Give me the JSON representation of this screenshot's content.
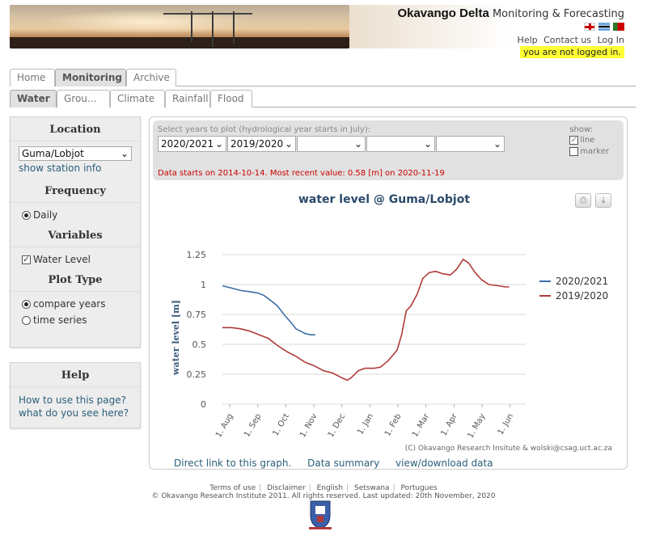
{
  "header": {
    "site_title_bold": "Okavango Delta",
    "site_title_rest": "Monitoring & Forecasting",
    "links": [
      "Help",
      "Contact us",
      "Log In"
    ],
    "login_status": "you are not logged in.",
    "flags": [
      "english-flag-icon",
      "botswana-flag-icon",
      "portugal-flag-icon"
    ]
  },
  "tabs_top": [
    "Home",
    "Monitoring",
    "Archive"
  ],
  "tabs_top_active": "Monitoring",
  "tabs_sub": [
    "Water",
    "Grou...",
    "Climate",
    "Rainfall",
    "Flood"
  ],
  "tabs_sub_active": "Water",
  "sidebar": {
    "location_heading": "Location",
    "location_value": "Guma/Lobjot",
    "station_info_link": "show station info",
    "frequency_heading": "Frequency",
    "frequency_option": "Daily",
    "variables_heading": "Variables",
    "variable_option": "Water Level",
    "plot_type_heading": "Plot Type",
    "plot_type_options": [
      "compare years",
      "time series"
    ],
    "help_heading": "Help",
    "help_links": [
      "How to use this page?",
      "what do you see here?"
    ]
  },
  "controls": {
    "hint": "Select years to plot (hydrological year starts in July):",
    "year_selects": [
      "2020/2021",
      "2019/2020",
      "",
      "",
      ""
    ],
    "show_label": "show:",
    "show_line": "line",
    "show_marker": "marker",
    "message": "Data starts on 2014-10-14. Most recent value: 0.58 [m] on 2020-11-19"
  },
  "chart_data": {
    "type": "line",
    "title": "water level @ Guma/Lobjot",
    "ylabel": "water level [m]",
    "xlabel": "",
    "ylim": [
      0,
      1.25
    ],
    "yticks": [
      "0",
      "0.25",
      "0.5",
      "0.75",
      "1",
      "1.25"
    ],
    "xticks": [
      "1. Aug",
      "1. Sep",
      "1. Oct",
      "1. Nov",
      "1. Dec",
      "1. Jan",
      "1. Feb",
      "1. Mar",
      "1. Apr",
      "1. May",
      "1. Jun"
    ],
    "credit": "(C) Okavango Research Insitute & wolski@csag.uct.ac.za",
    "legend_position": "right",
    "grid": true,
    "series": [
      {
        "name": "2020/2021",
        "color": "#3a6ea5",
        "points": [
          [
            0,
            0.99
          ],
          [
            5,
            0.98
          ],
          [
            10,
            0.97
          ],
          [
            15,
            0.96
          ],
          [
            20,
            0.95
          ],
          [
            30,
            0.94
          ],
          [
            38,
            0.93
          ],
          [
            45,
            0.91
          ],
          [
            52,
            0.87
          ],
          [
            60,
            0.82
          ],
          [
            68,
            0.74
          ],
          [
            75,
            0.68
          ],
          [
            80,
            0.63
          ],
          [
            85,
            0.61
          ],
          [
            90,
            0.59
          ],
          [
            96,
            0.58
          ],
          [
            101,
            0.58
          ]
        ]
      },
      {
        "name": "2019/2020",
        "color": "#b03a3a",
        "points": [
          [
            0,
            0.64
          ],
          [
            10,
            0.64
          ],
          [
            20,
            0.63
          ],
          [
            30,
            0.61
          ],
          [
            40,
            0.58
          ],
          [
            50,
            0.55
          ],
          [
            60,
            0.49
          ],
          [
            70,
            0.44
          ],
          [
            80,
            0.4
          ],
          [
            90,
            0.35
          ],
          [
            100,
            0.32
          ],
          [
            110,
            0.28
          ],
          [
            120,
            0.26
          ],
          [
            130,
            0.22
          ],
          [
            136,
            0.2
          ],
          [
            140,
            0.22
          ],
          [
            148,
            0.28
          ],
          [
            155,
            0.3
          ],
          [
            165,
            0.3
          ],
          [
            172,
            0.31
          ],
          [
            180,
            0.36
          ],
          [
            190,
            0.45
          ],
          [
            195,
            0.58
          ],
          [
            200,
            0.78
          ],
          [
            205,
            0.82
          ],
          [
            212,
            0.92
          ],
          [
            218,
            1.05
          ],
          [
            225,
            1.1
          ],
          [
            232,
            1.11
          ],
          [
            240,
            1.09
          ],
          [
            248,
            1.08
          ],
          [
            255,
            1.13
          ],
          [
            262,
            1.21
          ],
          [
            268,
            1.18
          ],
          [
            275,
            1.1
          ],
          [
            282,
            1.04
          ],
          [
            290,
            1.0
          ],
          [
            300,
            0.99
          ],
          [
            308,
            0.98
          ],
          [
            312,
            0.98
          ]
        ]
      }
    ]
  },
  "graph_links": [
    "Direct link to this graph.",
    "Data summary",
    "view/download data"
  ],
  "footer": {
    "links": [
      "Terms of use",
      "Disclaimer",
      "English",
      "Setswana",
      "Portugues"
    ],
    "copyright": "© Okavango Research Institute 2011.  All rights reserved. Last updated: 20th November, 2020"
  }
}
